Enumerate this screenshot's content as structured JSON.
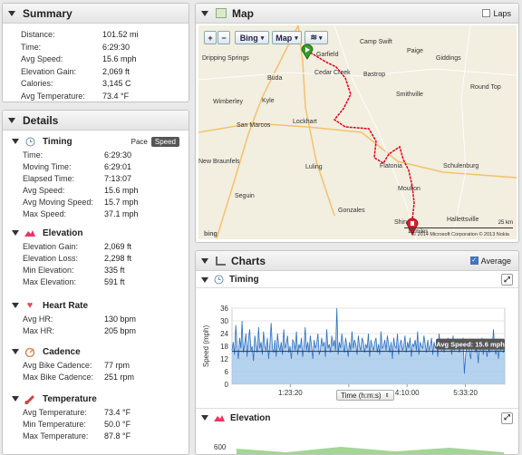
{
  "summary": {
    "title": "Summary",
    "rows": [
      {
        "label": "Distance:",
        "value": "101.52 mi"
      },
      {
        "label": "Time:",
        "value": "6:29:30"
      },
      {
        "label": "Avg Speed:",
        "value": "15.6 mph"
      },
      {
        "label": "Elevation Gain:",
        "value": "2,069 ft"
      },
      {
        "label": "Calories:",
        "value": "3,145 C"
      },
      {
        "label": "Avg Temperature:",
        "value": "73.4 °F"
      }
    ]
  },
  "details": {
    "title": "Details",
    "timing": {
      "title": "Timing",
      "pace_label": "Pace",
      "speed_label": "Speed",
      "rows": [
        {
          "label": "Time:",
          "value": "6:29:30"
        },
        {
          "label": "Moving Time:",
          "value": "6:29:01"
        },
        {
          "label": "Elapsed Time:",
          "value": "7:13:07"
        },
        {
          "label": "Avg Speed:",
          "value": "15.6 mph"
        },
        {
          "label": "Avg Moving Speed:",
          "value": "15.7 mph"
        },
        {
          "label": "Max Speed:",
          "value": "37.1 mph"
        }
      ]
    },
    "elevation": {
      "title": "Elevation",
      "rows": [
        {
          "label": "Elevation Gain:",
          "value": "2,069 ft"
        },
        {
          "label": "Elevation Loss:",
          "value": "2,298 ft"
        },
        {
          "label": "Min Elevation:",
          "value": "335 ft"
        },
        {
          "label": "Max Elevation:",
          "value": "591 ft"
        }
      ]
    },
    "heart_rate": {
      "title": "Heart Rate",
      "rows": [
        {
          "label": "Avg HR:",
          "value": "130 bpm"
        },
        {
          "label": "Max HR:",
          "value": "205 bpm"
        }
      ]
    },
    "cadence": {
      "title": "Cadence",
      "rows": [
        {
          "label": "Avg Bike Cadence:",
          "value": "77 rpm"
        },
        {
          "label": "Max Bike Cadence:",
          "value": "251 rpm"
        }
      ]
    },
    "temperature": {
      "title": "Temperature",
      "rows": [
        {
          "label": "Avg Temperature:",
          "value": "73.4 °F"
        },
        {
          "label": "Min Temperature:",
          "value": "50.0 °F"
        },
        {
          "label": "Max Temperature:",
          "value": "87.8 °F"
        }
      ]
    }
  },
  "map": {
    "title": "Map",
    "laps_label": "Laps",
    "zoom_in": "+",
    "zoom_out": "−",
    "bing_label": "Bing",
    "map_label": "Map",
    "places": [
      "Dripping Springs",
      "Buda",
      "Kyle",
      "Wimberley",
      "San Marcos",
      "New Braunfels",
      "Seguin",
      "Lockhart",
      "Luling",
      "Garfield",
      "Cedar Creek",
      "Bastrop",
      "Paige",
      "Giddings",
      "Camp Swift",
      "Smithville",
      "Flatonia",
      "Schulenburg",
      "Moulton",
      "Gonzales",
      "Hallettsville",
      "Shiner",
      "Round Top"
    ],
    "scale_mi": "10 miles",
    "scale_km": "25 km",
    "copyright": "© 2014 Microsoft Corporation  © 2013 Nokia",
    "bing_logo": "bing"
  },
  "charts": {
    "title": "Charts",
    "average_label": "Average",
    "timing": {
      "title": "Timing",
      "xaxis_label": "Time (h:m:s)"
    },
    "elevation": {
      "title": "Elevation",
      "first_tick": "600"
    }
  },
  "chart_data": {
    "type": "area",
    "title": "Timing",
    "xlabel": "Time (h:m:s)",
    "ylabel": "Speed (mph)",
    "ylim": [
      0,
      36
    ],
    "yticks": [
      0,
      6,
      12,
      18,
      24,
      30,
      36
    ],
    "xticks": [
      "1:23:20",
      "2:46:40",
      "4:10:00",
      "5:33:20"
    ],
    "xtick_seconds": [
      5000,
      10000,
      15000,
      20000
    ],
    "xlim_seconds": [
      0,
      23370
    ],
    "average": 15.6,
    "average_label": "Avg Speed: 15.6 mph",
    "series": [
      {
        "values": [
          16,
          20,
          14,
          28,
          18,
          12,
          22,
          17,
          30,
          15,
          19,
          24,
          13,
          21,
          26,
          16,
          18,
          11,
          23,
          19,
          15,
          27,
          17,
          20,
          14,
          25,
          18,
          16,
          22,
          12,
          19,
          29,
          17,
          15,
          21,
          13,
          24,
          18,
          16,
          20,
          14,
          26,
          17,
          19,
          23,
          15,
          18,
          12,
          21,
          20,
          16,
          25,
          14,
          19,
          17,
          22,
          13,
          18,
          27,
          16,
          20,
          15,
          23,
          18,
          12,
          21,
          17,
          19,
          24,
          14,
          16,
          22,
          18,
          20,
          13,
          26,
          17,
          19,
          15,
          23,
          18,
          21,
          16,
          36,
          14,
          20,
          17,
          24,
          19,
          15,
          22,
          18,
          13,
          20,
          16,
          25,
          17,
          21,
          19,
          14,
          23,
          18,
          16,
          22,
          20,
          15,
          19,
          17,
          24,
          13,
          21,
          18,
          16,
          20,
          22,
          15,
          19,
          14,
          25,
          17,
          18,
          21,
          16,
          23,
          19,
          15,
          20,
          12,
          22,
          18,
          17,
          24,
          14,
          19,
          21,
          16,
          18,
          23,
          15,
          20,
          17,
          22,
          13,
          19,
          18,
          21,
          16,
          25,
          14,
          20,
          18,
          17,
          23,
          19,
          15,
          21,
          16,
          18,
          22,
          14,
          20,
          17,
          19,
          13,
          24,
          18,
          16,
          21,
          15,
          20,
          18,
          22,
          17,
          19,
          14,
          23,
          16,
          20,
          18,
          21,
          15,
          19,
          17,
          22,
          5,
          14,
          18,
          20,
          16,
          12,
          19,
          17,
          21,
          15,
          18,
          10,
          20,
          16,
          22,
          14,
          19,
          17,
          13,
          18,
          15,
          21,
          16,
          26,
          17,
          14,
          19,
          12,
          18,
          16,
          20,
          15,
          17
        ]
      }
    ]
  }
}
